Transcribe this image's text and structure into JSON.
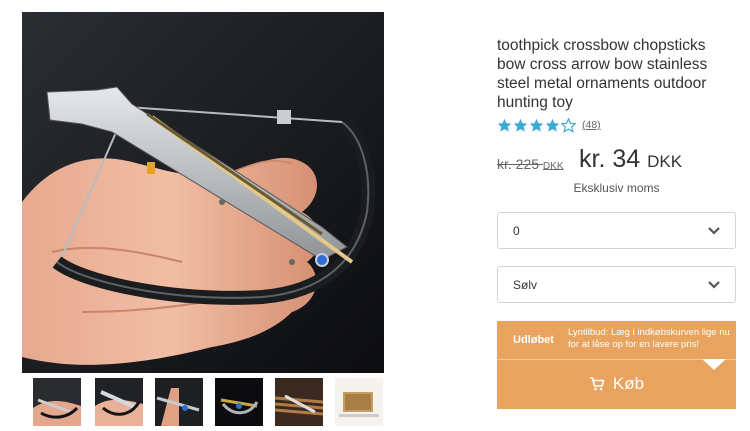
{
  "product": {
    "title": "toothpick crossbow chopsticks bow cross arrow bow stainless steel metal ornaments outdoor hunting toy",
    "rating": {
      "stars": 4,
      "max": 5,
      "review_count": "(48)"
    },
    "price": {
      "old_value": "kr. 225",
      "old_currency": "DKK",
      "new_value": "kr. 34",
      "new_currency": "DKK",
      "vat_note": "Eksklusiv moms"
    },
    "options": {
      "quantity_selected": "0",
      "color_selected": "Sølv"
    },
    "deal": {
      "status": "Udløbet",
      "text": "Lyntilbud: Læg i indkøbskurven lige nu for at låse op for en lavere pris!"
    },
    "buy_label": "Køb"
  },
  "colors": {
    "accent": "#e8a35f",
    "star": "#3fa9d6"
  },
  "icons": {
    "star": "star-icon",
    "chevron": "chevron-down-icon",
    "cart": "cart-icon"
  }
}
